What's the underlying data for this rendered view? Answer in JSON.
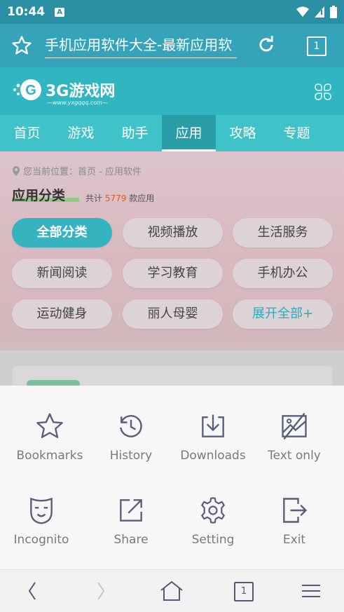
{
  "status_bar": {
    "time": "10:44",
    "notification_icon": "A"
  },
  "toolbar": {
    "url_text": "手机应用软件大全-最新应用软",
    "tab_count": "1"
  },
  "site": {
    "logo_name": "3G游戏网",
    "logo_domain": "—www.yxgqqq.com—"
  },
  "nav": {
    "items": [
      "首页",
      "游戏",
      "助手",
      "应用",
      "攻略",
      "专题"
    ],
    "active_index": 3
  },
  "page": {
    "breadcrumb": "您当前位置：首页 - 应用软件",
    "section_title": "应用分类",
    "total_prefix": "共计",
    "total_count": "5779",
    "total_suffix": "款应用",
    "categories": [
      "全部分类",
      "视频播放",
      "生活服务",
      "新闻阅读",
      "学习教育",
      "手机办公",
      "运动健身",
      "丽人母婴",
      "展开全部+"
    ]
  },
  "menu": {
    "items": [
      {
        "label": "Bookmarks",
        "icon": "star-icon"
      },
      {
        "label": "History",
        "icon": "history-icon"
      },
      {
        "label": "Downloads",
        "icon": "download-icon"
      },
      {
        "label": "Text only",
        "icon": "text-only-icon"
      },
      {
        "label": "Incognito",
        "icon": "incognito-mask-icon"
      },
      {
        "label": "Share",
        "icon": "share-icon"
      },
      {
        "label": "Setting",
        "icon": "gear-icon"
      },
      {
        "label": "Exit",
        "icon": "exit-icon"
      }
    ]
  },
  "bottom_bar": {
    "tab_count": "1"
  },
  "colors": {
    "toolbar": "#35a4bb",
    "site_header": "#2fb6c0",
    "nav": "#3fc2c8",
    "accent": "#35b4bf"
  }
}
